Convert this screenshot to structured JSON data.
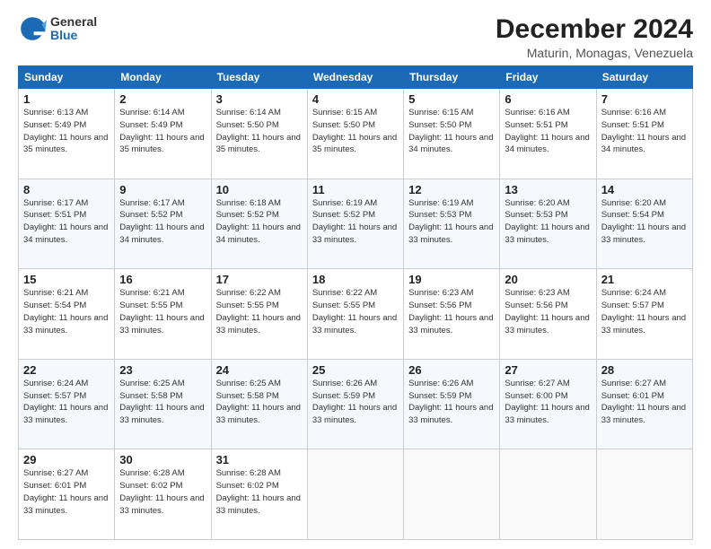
{
  "logo": {
    "general": "General",
    "blue": "Blue"
  },
  "title": "December 2024",
  "subtitle": "Maturin, Monagas, Venezuela",
  "weekdays": [
    "Sunday",
    "Monday",
    "Tuesday",
    "Wednesday",
    "Thursday",
    "Friday",
    "Saturday"
  ],
  "weeks": [
    [
      {
        "day": 1,
        "rise": "6:13 AM",
        "set": "5:49 PM",
        "daylight": "11 hours and 35 minutes."
      },
      {
        "day": 2,
        "rise": "6:14 AM",
        "set": "5:49 PM",
        "daylight": "11 hours and 35 minutes."
      },
      {
        "day": 3,
        "rise": "6:14 AM",
        "set": "5:50 PM",
        "daylight": "11 hours and 35 minutes."
      },
      {
        "day": 4,
        "rise": "6:15 AM",
        "set": "5:50 PM",
        "daylight": "11 hours and 35 minutes."
      },
      {
        "day": 5,
        "rise": "6:15 AM",
        "set": "5:50 PM",
        "daylight": "11 hours and 34 minutes."
      },
      {
        "day": 6,
        "rise": "6:16 AM",
        "set": "5:51 PM",
        "daylight": "11 hours and 34 minutes."
      },
      {
        "day": 7,
        "rise": "6:16 AM",
        "set": "5:51 PM",
        "daylight": "11 hours and 34 minutes."
      }
    ],
    [
      {
        "day": 8,
        "rise": "6:17 AM",
        "set": "5:51 PM",
        "daylight": "11 hours and 34 minutes."
      },
      {
        "day": 9,
        "rise": "6:17 AM",
        "set": "5:52 PM",
        "daylight": "11 hours and 34 minutes."
      },
      {
        "day": 10,
        "rise": "6:18 AM",
        "set": "5:52 PM",
        "daylight": "11 hours and 34 minutes."
      },
      {
        "day": 11,
        "rise": "6:19 AM",
        "set": "5:52 PM",
        "daylight": "11 hours and 33 minutes."
      },
      {
        "day": 12,
        "rise": "6:19 AM",
        "set": "5:53 PM",
        "daylight": "11 hours and 33 minutes."
      },
      {
        "day": 13,
        "rise": "6:20 AM",
        "set": "5:53 PM",
        "daylight": "11 hours and 33 minutes."
      },
      {
        "day": 14,
        "rise": "6:20 AM",
        "set": "5:54 PM",
        "daylight": "11 hours and 33 minutes."
      }
    ],
    [
      {
        "day": 15,
        "rise": "6:21 AM",
        "set": "5:54 PM",
        "daylight": "11 hours and 33 minutes."
      },
      {
        "day": 16,
        "rise": "6:21 AM",
        "set": "5:55 PM",
        "daylight": "11 hours and 33 minutes."
      },
      {
        "day": 17,
        "rise": "6:22 AM",
        "set": "5:55 PM",
        "daylight": "11 hours and 33 minutes."
      },
      {
        "day": 18,
        "rise": "6:22 AM",
        "set": "5:55 PM",
        "daylight": "11 hours and 33 minutes."
      },
      {
        "day": 19,
        "rise": "6:23 AM",
        "set": "5:56 PM",
        "daylight": "11 hours and 33 minutes."
      },
      {
        "day": 20,
        "rise": "6:23 AM",
        "set": "5:56 PM",
        "daylight": "11 hours and 33 minutes."
      },
      {
        "day": 21,
        "rise": "6:24 AM",
        "set": "5:57 PM",
        "daylight": "11 hours and 33 minutes."
      }
    ],
    [
      {
        "day": 22,
        "rise": "6:24 AM",
        "set": "5:57 PM",
        "daylight": "11 hours and 33 minutes."
      },
      {
        "day": 23,
        "rise": "6:25 AM",
        "set": "5:58 PM",
        "daylight": "11 hours and 33 minutes."
      },
      {
        "day": 24,
        "rise": "6:25 AM",
        "set": "5:58 PM",
        "daylight": "11 hours and 33 minutes."
      },
      {
        "day": 25,
        "rise": "6:26 AM",
        "set": "5:59 PM",
        "daylight": "11 hours and 33 minutes."
      },
      {
        "day": 26,
        "rise": "6:26 AM",
        "set": "5:59 PM",
        "daylight": "11 hours and 33 minutes."
      },
      {
        "day": 27,
        "rise": "6:27 AM",
        "set": "6:00 PM",
        "daylight": "11 hours and 33 minutes."
      },
      {
        "day": 28,
        "rise": "6:27 AM",
        "set": "6:01 PM",
        "daylight": "11 hours and 33 minutes."
      }
    ],
    [
      {
        "day": 29,
        "rise": "6:27 AM",
        "set": "6:01 PM",
        "daylight": "11 hours and 33 minutes."
      },
      {
        "day": 30,
        "rise": "6:28 AM",
        "set": "6:02 PM",
        "daylight": "11 hours and 33 minutes."
      },
      {
        "day": 31,
        "rise": "6:28 AM",
        "set": "6:02 PM",
        "daylight": "11 hours and 33 minutes."
      },
      null,
      null,
      null,
      null
    ]
  ]
}
